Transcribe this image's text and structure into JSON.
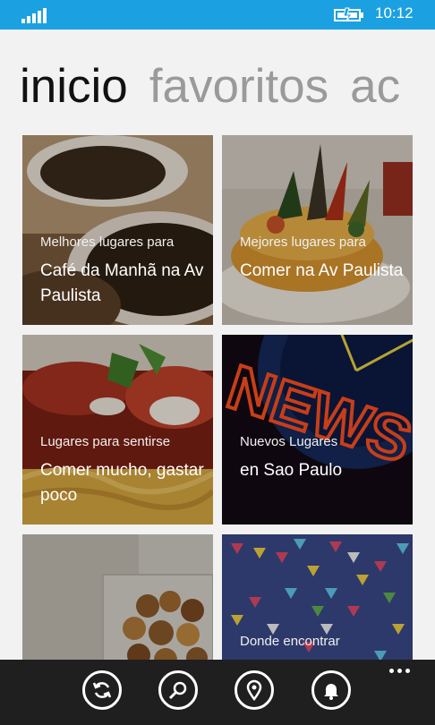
{
  "status_bar": {
    "time": "10:12",
    "icons": [
      "signal-icon",
      "battery-charging-icon"
    ],
    "color": "#1ba1e2"
  },
  "pivot": {
    "items": [
      {
        "label": "inicio",
        "active": true
      },
      {
        "label": "favoritos",
        "active": false
      },
      {
        "label": "ac",
        "active": false
      }
    ]
  },
  "tiles": [
    {
      "subtitle": "Melhores lugares para",
      "title": "Café da Manhã na Av Paulista",
      "image": "coffee-beans-image"
    },
    {
      "subtitle": "Mejores lugares para",
      "title": "Comer na Av Paulista",
      "image": "pastry-dish-image"
    },
    {
      "subtitle": "Lugares para sentirse",
      "title": "Comer mucho, gastar poco",
      "image": "pasta-dish-image"
    },
    {
      "subtitle": "Nuevos Lugares",
      "title": "en Sao Paulo",
      "image": "neon-news-sign-image"
    },
    {
      "subtitle": "",
      "title": "",
      "image": "coin-jar-image"
    },
    {
      "subtitle": "Donde encontrar",
      "title": "",
      "image": "festive-flags-image"
    }
  ],
  "app_bar": {
    "buttons": [
      "refresh-icon",
      "search-icon",
      "location-icon",
      "notification-bell-icon"
    ],
    "more": "more-options-icon"
  }
}
